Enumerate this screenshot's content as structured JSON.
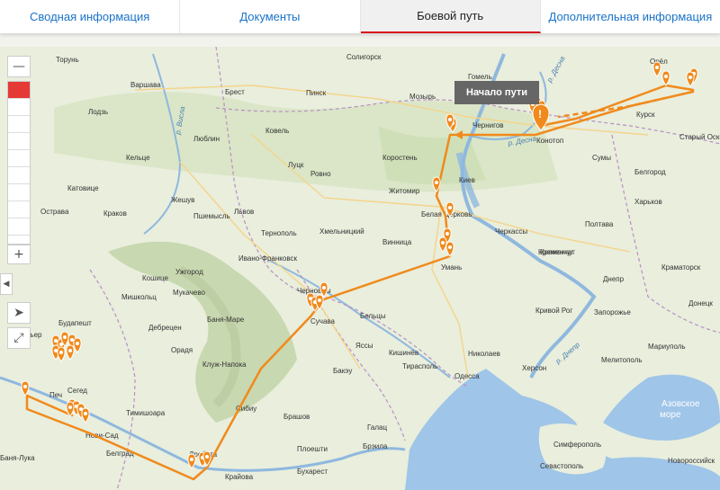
{
  "tabs": [
    {
      "label": "Сводная информация"
    },
    {
      "label": "Документы"
    },
    {
      "label": "Боевой путь"
    },
    {
      "label": "Дополнительная информация"
    }
  ],
  "active_tab": "Боевой путь",
  "tooltip": {
    "label": "Начало пути"
  },
  "map": {
    "controls": {
      "zoom_out": "—",
      "zoom_in": "+",
      "left": "◀",
      "locate": "➤",
      "fullscreen": "⤢"
    },
    "cities": [
      {
        "name": "Торунь"
      },
      {
        "name": "Варшава"
      },
      {
        "name": "Лодзь"
      },
      {
        "name": "Люблин"
      },
      {
        "name": "Кельце"
      },
      {
        "name": "Катовице"
      },
      {
        "name": "Краков"
      },
      {
        "name": "Острава"
      },
      {
        "name": "Жешув"
      },
      {
        "name": "Пшемысль"
      },
      {
        "name": "Брест"
      },
      {
        "name": "Пинск"
      },
      {
        "name": "Мозырь"
      },
      {
        "name": "Гомель"
      },
      {
        "name": "Солигорск"
      },
      {
        "name": "Ковель"
      },
      {
        "name": "Луцк"
      },
      {
        "name": "Ровно"
      },
      {
        "name": "Коростень"
      },
      {
        "name": "Житомир"
      },
      {
        "name": "Чернигов"
      },
      {
        "name": "Киев"
      },
      {
        "name": "Белая Церковь"
      },
      {
        "name": "Конотоп"
      },
      {
        "name": "Сумы"
      },
      {
        "name": "Курск"
      },
      {
        "name": "Орёл"
      },
      {
        "name": "Старый Оскол"
      },
      {
        "name": "Белгород"
      },
      {
        "name": "Харьков"
      },
      {
        "name": "Полтава"
      },
      {
        "name": "Черкассы"
      },
      {
        "name": "Кременчуг"
      },
      {
        "name": "Краматорск"
      },
      {
        "name": "Донецк"
      },
      {
        "name": "Днепр"
      },
      {
        "name": "Запорожье"
      },
      {
        "name": "Кривой Рог"
      },
      {
        "name": "Мариуполь"
      },
      {
        "name": "Мелитополь"
      },
      {
        "name": "Херсон"
      },
      {
        "name": "Николаев"
      },
      {
        "name": "Одесса"
      },
      {
        "name": "Умань"
      },
      {
        "name": "Винница"
      },
      {
        "name": "Хмельницкий"
      },
      {
        "name": "Тернополь"
      },
      {
        "name": "Львов"
      },
      {
        "name": "Ивано-Франковск"
      },
      {
        "name": "Ужгород"
      },
      {
        "name": "Мукачево"
      },
      {
        "name": "Черновцы"
      },
      {
        "name": "Сучава"
      },
      {
        "name": "Бельцы"
      },
      {
        "name": "Яссы"
      },
      {
        "name": "Кишинёв"
      },
      {
        "name": "Тирасполь"
      },
      {
        "name": "Бакэу"
      },
      {
        "name": "Галац"
      },
      {
        "name": "Брэила"
      },
      {
        "name": "Брашов"
      },
      {
        "name": "Сибиу"
      },
      {
        "name": "Плоешти"
      },
      {
        "name": "Бухарест"
      },
      {
        "name": "Крайова"
      },
      {
        "name": "Дробета"
      },
      {
        "name": "Клуж-Напока"
      },
      {
        "name": "Орадя"
      },
      {
        "name": "Баня-Маре"
      },
      {
        "name": "Дебрецен"
      },
      {
        "name": "Мишкольц"
      },
      {
        "name": "Будапешт"
      },
      {
        "name": "Кошице"
      },
      {
        "name": "Сегед"
      },
      {
        "name": "Тимишоара"
      },
      {
        "name": "Нови-Сад"
      },
      {
        "name": "Белград"
      },
      {
        "name": "Баня-Лука"
      },
      {
        "name": "Печ"
      },
      {
        "name": "Дьер"
      },
      {
        "name": "Кременчуг"
      },
      {
        "name": "Севастополь"
      },
      {
        "name": "Новороссийск"
      },
      {
        "name": "Симферополь"
      }
    ],
    "sea_label": "Азовское море",
    "rivers": [
      "р. Десна",
      "р. Днепр",
      "р. Висла",
      "р. Десна"
    ]
  },
  "route": {
    "color": "#f08a1c",
    "marker_count": 37
  }
}
